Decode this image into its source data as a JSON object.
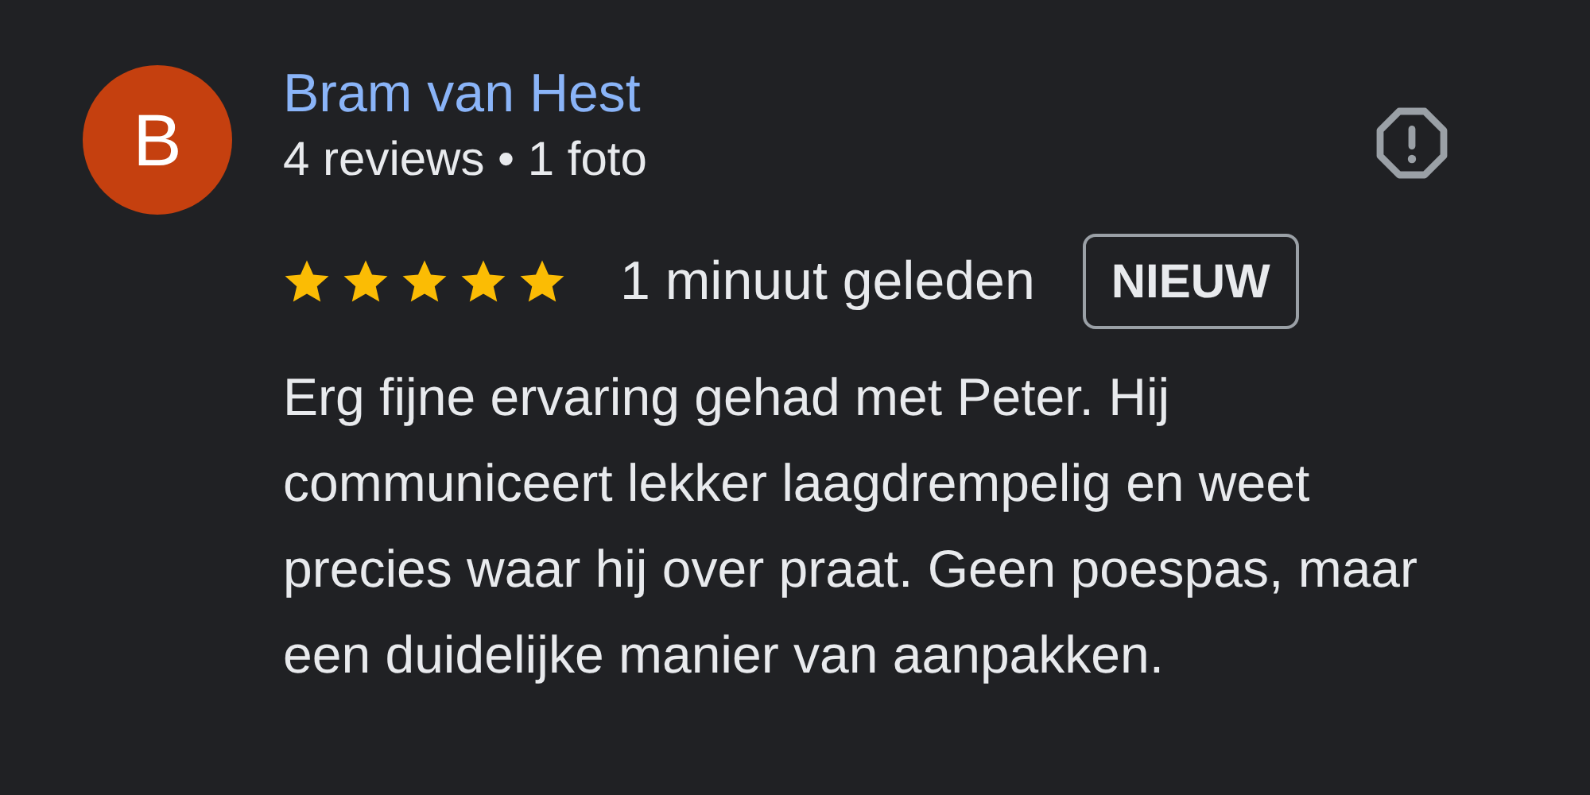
{
  "review": {
    "avatar_letter": "B",
    "author": "Bram van Hest",
    "author_meta": "4 reviews • 1 foto",
    "stars": 5,
    "time": "1 minuut geleden",
    "badge": "NIEUW",
    "text": "Erg fijne ervaring gehad met Peter. Hij communiceert lekker laagdrempelig en weet precies waar hij over praat. Geen poespas, maar een duidelijke manier van aanpakken."
  }
}
